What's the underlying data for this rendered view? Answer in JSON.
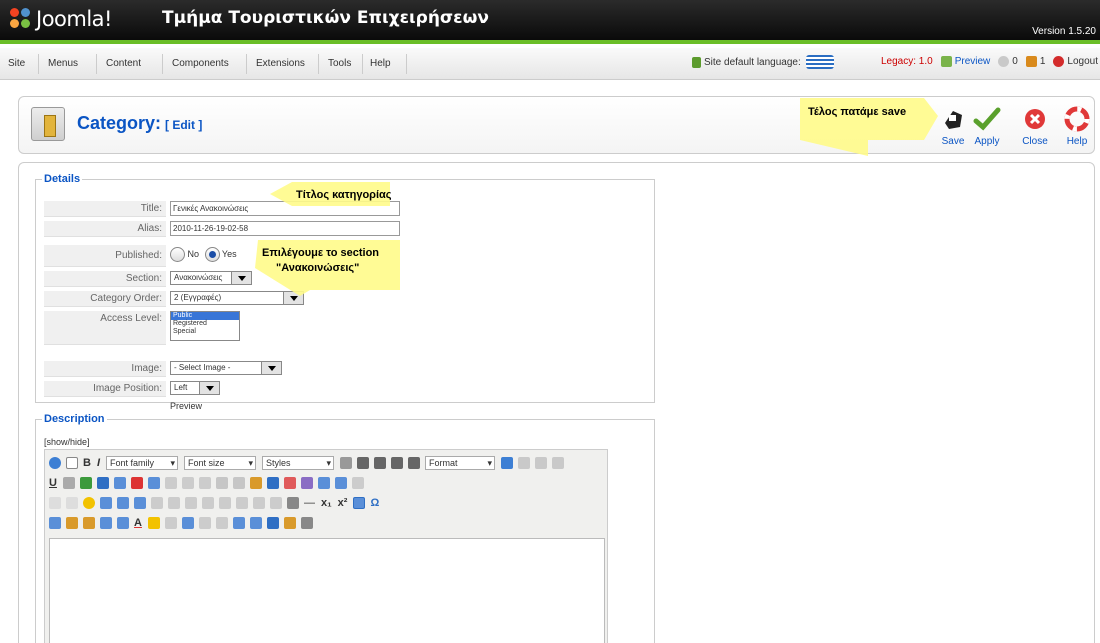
{
  "header": {
    "logo_text": "Joomla!",
    "site_title": "Τμήμα Τουριστικών Επιχειρήσεων",
    "version": "Version 1.5.20"
  },
  "menu": {
    "items": [
      "Site",
      "Menus",
      "Content",
      "Components",
      "Extensions",
      "Tools",
      "Help"
    ]
  },
  "status": {
    "site_language": "Site default language:",
    "legacy": "Legacy: 1.0",
    "preview": "Preview",
    "messages": "0",
    "users": "1",
    "logout": "Logout"
  },
  "toolbar": {
    "title": "Category:",
    "subtitle": "[ Edit ]",
    "buttons": [
      "Save",
      "Apply",
      "Close",
      "Help"
    ]
  },
  "details": {
    "legend": "Details",
    "title_label": "Title:",
    "title_value": "Γενικές Ανακοινώσεις",
    "alias_label": "Alias:",
    "alias_value": "2010-11-26-19-02-58",
    "published_label": "Published:",
    "published_no": "No",
    "published_yes": "Yes",
    "section_label": "Section:",
    "section_value": "Ανακοινώσεις",
    "order_label": "Category Order:",
    "order_value": "2 (Εγγραφές)",
    "access_label": "Access Level:",
    "access_options": [
      "Public",
      "Registered",
      "Special"
    ],
    "access_selected": "Public",
    "image_label": "Image:",
    "image_value": "- Select Image -",
    "image_position_label": "Image Position:",
    "image_position_value": "Left",
    "preview_label": "Preview"
  },
  "description": {
    "legend": "Description",
    "showhide": "[show/hide]",
    "font_family": "Font family",
    "font_size": "Font size",
    "styles": "Styles",
    "format": "Format"
  },
  "annotations": {
    "save_note": "Τέλος πατάμε save",
    "title_note": "Τίτλος κατηγορίας",
    "section_note_1": "Επιλέγουμε το section",
    "section_note_2": "\"Ανακοινώσεις\""
  },
  "colors": {
    "header_bg": "#1a1a1a",
    "accent_green": "#6abe28",
    "link_blue": "#0b55c4",
    "callout_yellow": "#fffb8a"
  }
}
